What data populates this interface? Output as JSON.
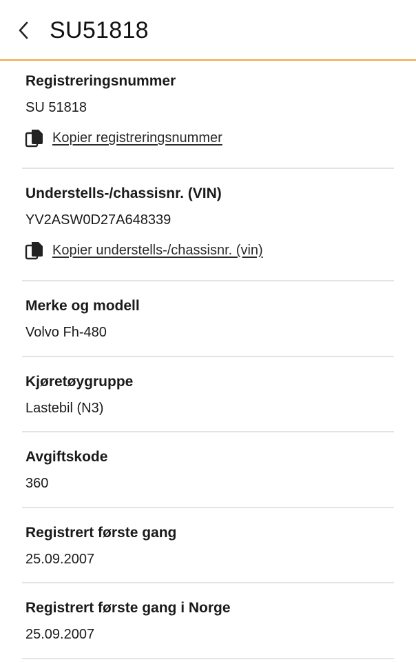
{
  "header": {
    "title": "SU51818"
  },
  "fields": [
    {
      "label": "Registreringsnummer",
      "value": "SU 51818",
      "copy_label": "Kopier registreringsnummer"
    },
    {
      "label": "Understells-/chassisnr. (VIN)",
      "value": "YV2ASW0D27A648339",
      "copy_label": "Kopier understells-/chassisnr. (vin)"
    },
    {
      "label": "Merke og modell",
      "value": "Volvo Fh-480"
    },
    {
      "label": "Kjøretøygruppe",
      "value": "Lastebil (N3)"
    },
    {
      "label": "Avgiftskode",
      "value": "360"
    },
    {
      "label": "Registrert første gang",
      "value": "25.09.2007"
    },
    {
      "label": "Registrert første gang i Norge",
      "value": "25.09.2007"
    }
  ],
  "colors": {
    "accent": "#f0a640",
    "divider": "#e3e3e3",
    "text": "#1a1a1a"
  },
  "icons": {
    "back": "chevron-left-icon",
    "copy": "copy-icon"
  }
}
